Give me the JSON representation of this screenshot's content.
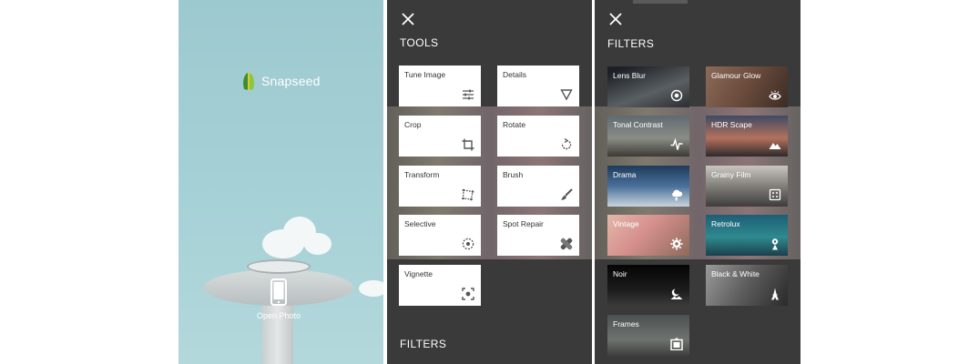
{
  "home": {
    "app_name": "Snapseed",
    "open_photo_label": "Open Photo"
  },
  "tools_panel": {
    "heading": "TOOLS",
    "footer_heading": "FILTERS",
    "items": [
      {
        "label": "Tune Image",
        "icon": "sliders-icon"
      },
      {
        "label": "Details",
        "icon": "triangle-icon"
      },
      {
        "label": "Crop",
        "icon": "crop-icon"
      },
      {
        "label": "Rotate",
        "icon": "rotate-icon"
      },
      {
        "label": "Transform",
        "icon": "perspective-icon"
      },
      {
        "label": "Brush",
        "icon": "brush-icon"
      },
      {
        "label": "Selective",
        "icon": "selective-icon"
      },
      {
        "label": "Spot Repair",
        "icon": "bandage-icon"
      },
      {
        "label": "Vignette",
        "icon": "vignette-icon"
      }
    ]
  },
  "filters_panel": {
    "heading": "FILTERS",
    "items": [
      {
        "label": "Lens Blur",
        "icon": "target-icon"
      },
      {
        "label": "Glamour Glow",
        "icon": "eye-icon"
      },
      {
        "label": "Tonal Contrast",
        "icon": "pulse-icon"
      },
      {
        "label": "HDR Scape",
        "icon": "mountain-icon"
      },
      {
        "label": "Drama",
        "icon": "cloud-bolt-icon"
      },
      {
        "label": "Grainy Film",
        "icon": "film-grain-icon"
      },
      {
        "label": "Vintage",
        "icon": "flower-icon"
      },
      {
        "label": "Retrolux",
        "icon": "retrolux-icon"
      },
      {
        "label": "Noir",
        "icon": "moon-landscape-icon"
      },
      {
        "label": "Black & White",
        "icon": "eiffel-tower-icon"
      },
      {
        "label": "Frames",
        "icon": "frame-icon"
      }
    ]
  },
  "colors": {
    "panel_bg": "#3a3a3a",
    "tile_bg": "#ffffff",
    "sky": "#a6d1d6",
    "logo_green": "#8cc63f"
  }
}
